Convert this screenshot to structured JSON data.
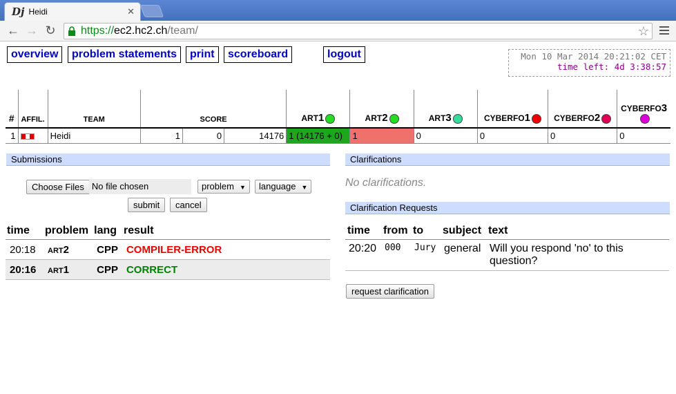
{
  "browser": {
    "tab_title": "Heidi",
    "favicon_text": "Dj",
    "url_scheme": "https://",
    "url_host": "ec2.hc2.ch",
    "url_path": "/team/"
  },
  "nav": {
    "overview": "overview",
    "problem_statements": "problem statements",
    "print": "print",
    "scoreboard": "scoreboard",
    "logout": "logout"
  },
  "clock": {
    "time": "Mon 10 Mar 2014 20:21:02 CET",
    "time_left": "time left: 4d 3:38:57"
  },
  "scoreboard": {
    "headers": {
      "rank": "#",
      "affil": "AFFIL.",
      "team": "TEAM",
      "score": "SCORE"
    },
    "problems": [
      {
        "prefix": "ART",
        "num": "1",
        "color": "#22dd22"
      },
      {
        "prefix": "ART",
        "num": "2",
        "color": "#22dd22"
      },
      {
        "prefix": "ART",
        "num": "3",
        "color": "#33dd99"
      },
      {
        "prefix": "CYBERFO",
        "num": "1",
        "color": "#ee0000"
      },
      {
        "prefix": "CYBERFO",
        "num": "2",
        "color": "#dd0055"
      },
      {
        "prefix": "CYBERFO",
        "num": "3",
        "color": "#dd00dd"
      }
    ],
    "row": {
      "rank": "1",
      "team": "Heidi",
      "solved": "1",
      "penalty": "0",
      "time": "14176",
      "cells": [
        "1 (14176 + 0)",
        "1",
        "0",
        "0",
        "0",
        "0"
      ]
    }
  },
  "submissions": {
    "heading": "Submissions",
    "choose_files": "Choose Files",
    "no_file": "No file chosen",
    "problem_select": "problem",
    "language_select": "language",
    "submit": "submit",
    "cancel": "cancel",
    "columns": [
      "time",
      "problem",
      "lang",
      "result"
    ],
    "rows": [
      {
        "time": "20:18",
        "prob_prefix": "ART",
        "prob_num": "2",
        "lang": "CPP",
        "result": "COMPILER-ERROR"
      },
      {
        "time": "20:16",
        "prob_prefix": "ART",
        "prob_num": "1",
        "lang": "CPP",
        "result": "CORRECT"
      }
    ]
  },
  "clarifications": {
    "heading": "Clarifications",
    "empty": "No clarifications.",
    "requests_heading": "Clarification Requests",
    "columns": [
      "time",
      "from",
      "to",
      "subject",
      "text"
    ],
    "rows": [
      {
        "time": "20:20",
        "from": "000",
        "to": "Jury",
        "subject": "general",
        "text": "Will you respond 'no' to this question?"
      }
    ],
    "request_button": "request clarification"
  }
}
